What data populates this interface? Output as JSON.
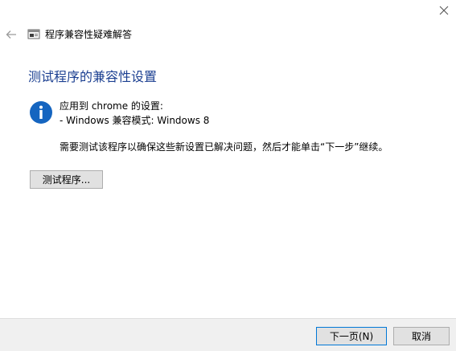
{
  "window": {
    "title": "程序兼容性疑难解答",
    "icons": {
      "close": "close-icon",
      "back": "back-arrow-icon",
      "wizard": "troubleshooter-icon",
      "info": "info-icon"
    }
  },
  "main": {
    "heading": "测试程序的兼容性设置",
    "applied_to": "应用到 chrome 的设置:",
    "mode": "- Windows 兼容模式: Windows 8",
    "instruction": "需要测试该程序以确保这些新设置已解决问题，然后才能单击“下一步”继续。",
    "test_button": "测试程序..."
  },
  "footer": {
    "next_button": "下一页(N)",
    "cancel_button": "取消"
  },
  "colors": {
    "heading": "#1b3f91",
    "info_blue": "#1565c0",
    "footer_bg": "#f0f0f0",
    "focus_border": "#0078d7"
  }
}
